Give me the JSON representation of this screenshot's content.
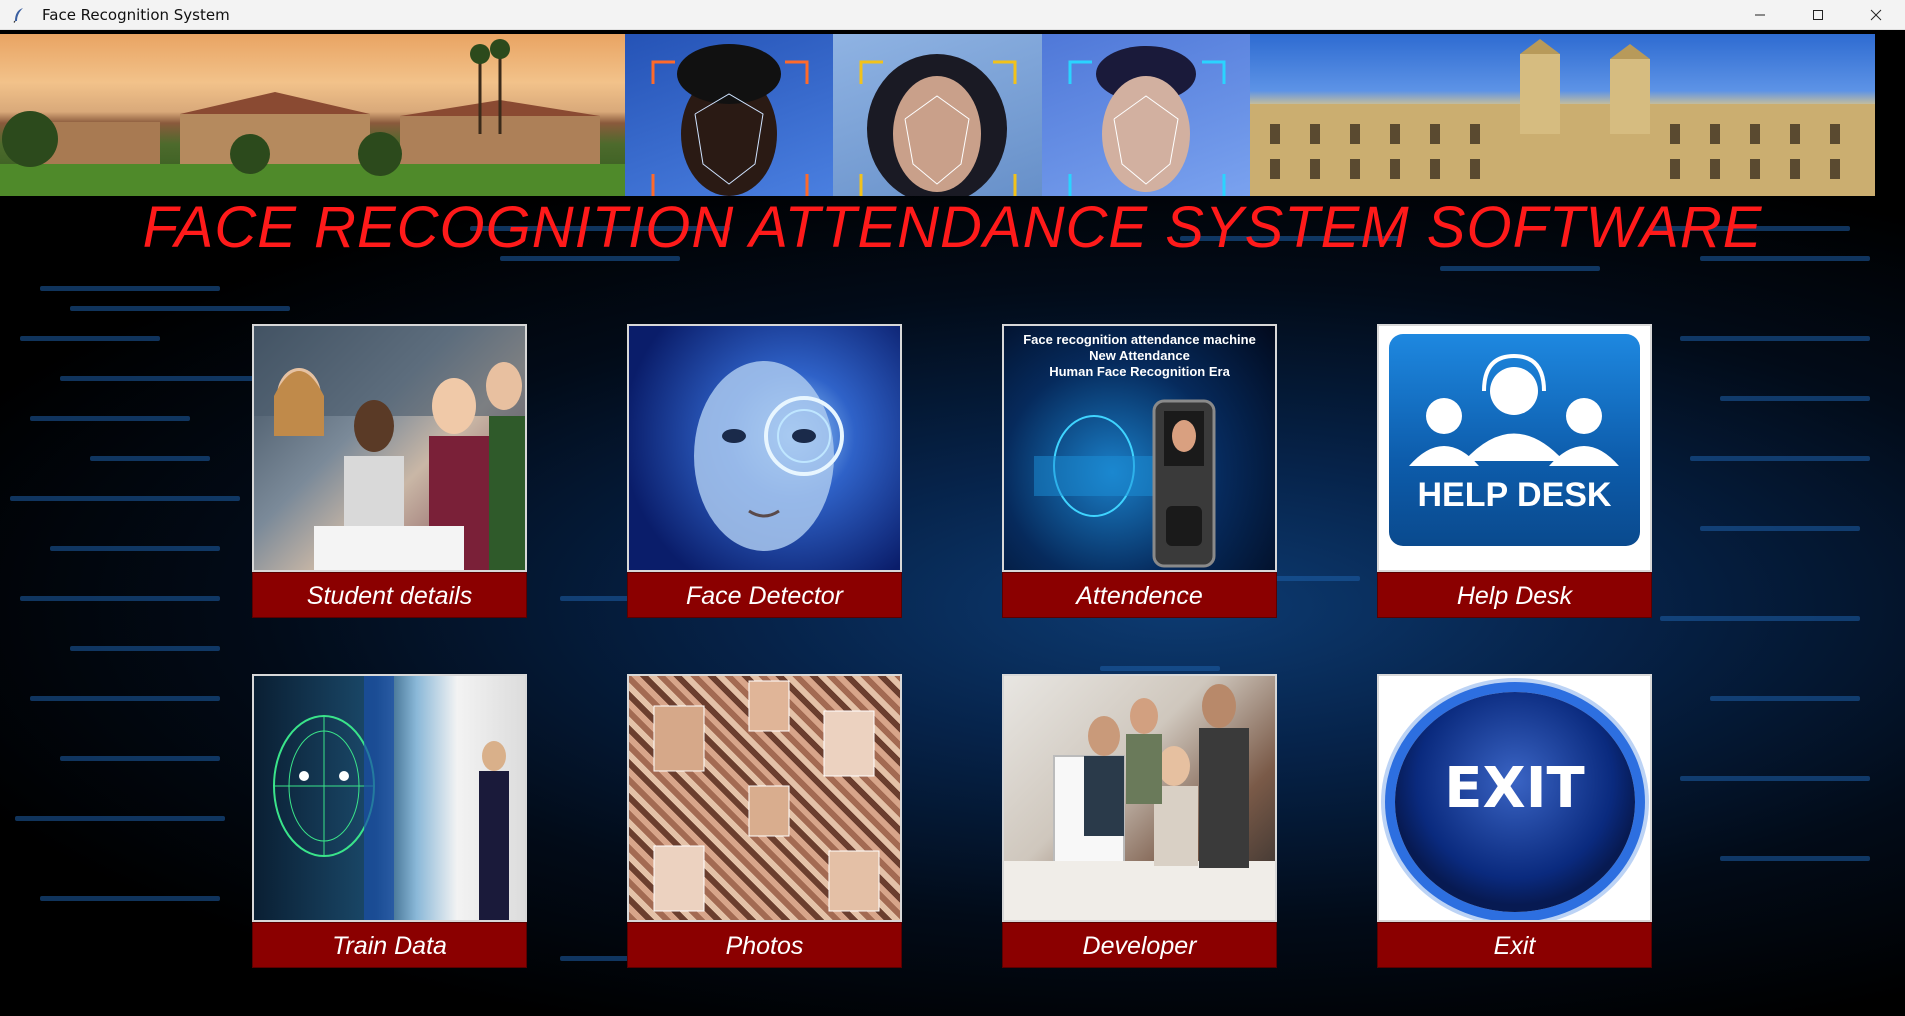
{
  "window": {
    "title": "Face Recognition System",
    "controls": [
      "minimize",
      "maximize",
      "close"
    ]
  },
  "header": {
    "title": "FACE RECOGNITION ATTENDANCE SYSTEM SOFTWARE",
    "title_color": "#ff1a1a"
  },
  "tiles": [
    {
      "label": "Student details",
      "icon": "students-image"
    },
    {
      "label": "Face Detector",
      "icon": "face-scan-image"
    },
    {
      "label": "Attendence",
      "icon": "attendance-machine-image",
      "caption": [
        "Face recognition attendance machine",
        "New Attendance",
        "Human Face Recognition Era"
      ]
    },
    {
      "label": "Help Desk",
      "icon": "help-desk-image",
      "image_text": "HELP DESK"
    },
    {
      "label": "Train Data",
      "icon": "train-data-image"
    },
    {
      "label": "Photos",
      "icon": "photos-collage-image"
    },
    {
      "label": "Developer",
      "icon": "developer-team-image"
    },
    {
      "label": "Exit",
      "icon": "exit-button-image",
      "image_text": "EXIT"
    }
  ],
  "colors": {
    "button_bg": "#8b0000",
    "button_text": "#ffffff",
    "background": "#000000"
  }
}
